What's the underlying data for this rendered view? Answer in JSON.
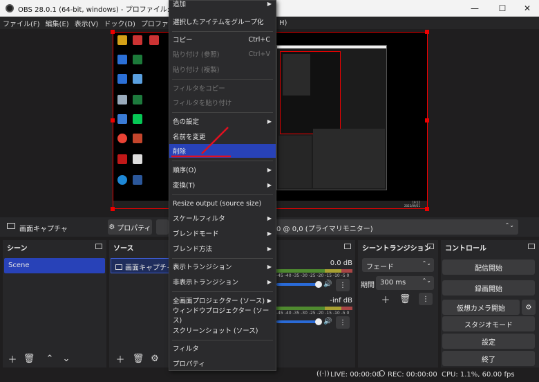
{
  "window": {
    "title": "OBS 28.0.1 (64-bit, windows) - プロファイル: Untitled - シーン",
    "minimize": "—",
    "maximize": "☐",
    "close": "✕"
  },
  "menubar": {
    "items": [
      "ファイル(F)",
      "編集(E)",
      "表示(V)",
      "ドック(D)",
      "プロファイル(P)"
    ],
    "trailing": "H)"
  },
  "preview": {
    "desktop_icons": [
      "Google Chrome",
      "PowerPoint",
      "McAfee",
      "Microsoft Edge",
      "Word",
      "Excel",
      "LINE",
      "Recycle Bin"
    ],
    "taskbar_time": "19:12",
    "taskbar_date": "2022/09/21"
  },
  "sourcebar": {
    "source_name": "画面キャプチャ",
    "properties_label": "プロパティ",
    "display_value": "0 @ 0,0 (プライマリモニター)"
  },
  "scenes": {
    "header": "シーン",
    "items": [
      "Scene"
    ]
  },
  "sources": {
    "header": "ソース",
    "items": [
      "画面キャプチャ"
    ]
  },
  "mixer": {
    "track1_db": "0.0 dB",
    "track2_db": "-inf dB",
    "scale": [
      "-45",
      "-40",
      "-35",
      "-30",
      "-25",
      "-20",
      "-15",
      "-10",
      "-5",
      "0"
    ]
  },
  "transitions": {
    "header": "シーントランジション",
    "type": "フェード",
    "duration_label": "期間",
    "duration_value": "300 ms"
  },
  "controls": {
    "header": "コントロール",
    "start_streaming": "配信開始",
    "start_recording": "録画開始",
    "start_virtual_camera": "仮想カメラ開始",
    "studio_mode": "スタジオモード",
    "settings": "設定",
    "exit": "終了"
  },
  "status": {
    "live": "LIVE: 00:00:00",
    "rec": "REC: 00:00:00",
    "cpu": "CPU: 1.1%, 60.00 fps"
  },
  "context_menu": {
    "items": [
      {
        "label": "追加",
        "submenu": true
      },
      {
        "label": "選択したアイテムをグループ化"
      },
      {
        "label": "コピー",
        "shortcut": "Ctrl+C"
      },
      {
        "label": "貼り付け (参照)",
        "shortcut": "Ctrl+V",
        "disabled": true
      },
      {
        "label": "貼り付け (複製)",
        "disabled": true
      },
      {
        "label": "フィルタをコピー",
        "disabled": true
      },
      {
        "label": "フィルタを貼り付け",
        "disabled": true
      },
      {
        "label": "色の設定",
        "submenu": true
      },
      {
        "label": "名前を変更"
      },
      {
        "label": "削除",
        "selected": true
      },
      {
        "label": "順序(O)",
        "submenu": true
      },
      {
        "label": "変換(T)",
        "submenu": true
      },
      {
        "label": "Resize output (source size)"
      },
      {
        "label": "スケールフィルタ",
        "submenu": true
      },
      {
        "label": "ブレンドモード",
        "submenu": true
      },
      {
        "label": "ブレンド方法",
        "submenu": true
      },
      {
        "label": "表示トランジション",
        "submenu": true
      },
      {
        "label": "非表示トランジション",
        "submenu": true
      },
      {
        "label": "全画面プロジェクター (ソース)",
        "submenu": true
      },
      {
        "label": "ウィンドウプロジェクター (ソース)"
      },
      {
        "label": "スクリーンショット (ソース)"
      },
      {
        "label": "フィルタ"
      },
      {
        "label": "プロパティ"
      }
    ],
    "submenu_arrow": "▶"
  }
}
